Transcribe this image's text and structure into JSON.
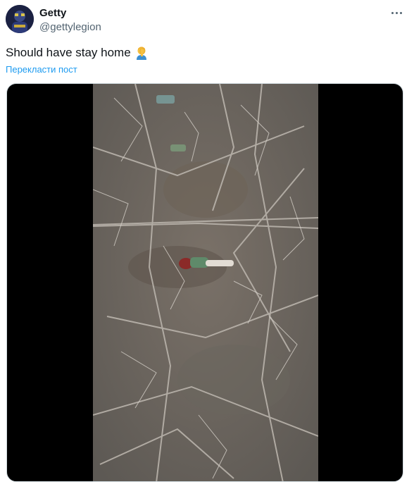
{
  "tweet": {
    "author": {
      "display_name": "Getty",
      "handle": "@gettylegion",
      "avatar_icon": "avatar-image"
    },
    "text": "Should have stay home",
    "emoji_icon": "person-facepalming-icon",
    "translate_label": "Перекласти пост",
    "more_icon": "more-horizontal-icon"
  },
  "colors": {
    "text_primary": "#0f1419",
    "text_secondary": "#536471",
    "link": "#1d9bf0",
    "media_background": "#000000"
  }
}
